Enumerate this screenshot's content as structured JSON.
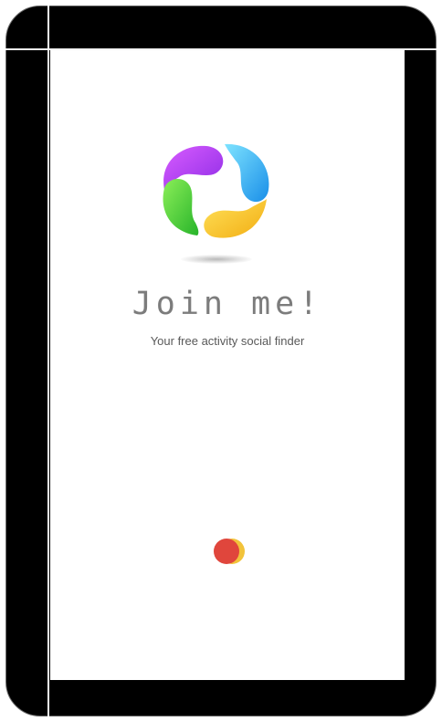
{
  "app": {
    "title": "Join me!",
    "tagline": "Your free activity social finder"
  },
  "logo": {
    "icon": "pinwheel-logo-icon",
    "colors": [
      "#b93df2",
      "#35b9f6",
      "#f5c41b",
      "#3fcf3a"
    ]
  },
  "loader": {
    "icon": "loading-spinner-icon",
    "colors": [
      "#e0463c",
      "#f2c33a"
    ]
  },
  "theme": {
    "frame": "#000000",
    "screen": "#ffffff",
    "title_color": "#7c7c7c",
    "subtitle_color": "#595959"
  }
}
